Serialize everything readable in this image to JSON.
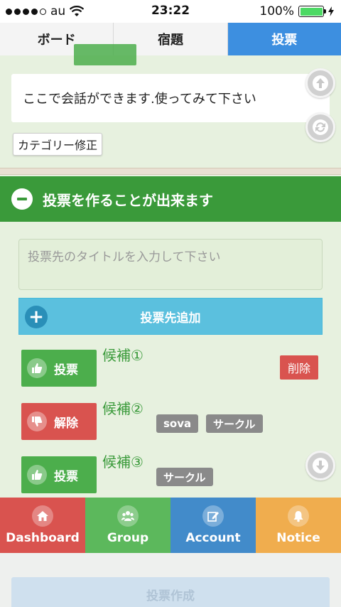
{
  "status_bar": {
    "carrier": "au",
    "time": "23:22",
    "battery": "100%"
  },
  "tabs": [
    {
      "label": "ボード"
    },
    {
      "label": "宿題"
    },
    {
      "label": "投票"
    }
  ],
  "chat": {
    "text": "ここで会話ができます.使ってみて下さい"
  },
  "category_edit_label": "カテゴリー修正",
  "poll": {
    "header": "投票を作ることが出来ます",
    "title_placeholder": "投票先のタイトルを入力して下さい",
    "add_option_label": "投票先追加",
    "candidates": [
      {
        "label": "候補①",
        "button": "投票",
        "state": "vote",
        "tags": [],
        "delete_label": "削除"
      },
      {
        "label": "候補②",
        "button": "解除",
        "state": "unvote",
        "tags": [
          "sova",
          "サークル"
        ]
      },
      {
        "label": "候補③",
        "button": "投票",
        "state": "vote",
        "tags": [
          "サークル"
        ]
      }
    ],
    "create_label": "投票作成"
  },
  "bottom_nav": [
    {
      "label": "Dashboard",
      "icon": "home-icon",
      "color": "#d9534f"
    },
    {
      "label": "Group",
      "icon": "group-icon",
      "color": "#5cb85c"
    },
    {
      "label": "Account",
      "icon": "edit-icon",
      "color": "#428bca"
    },
    {
      "label": "Notice",
      "icon": "bell-icon",
      "color": "#f0ad4e"
    }
  ]
}
